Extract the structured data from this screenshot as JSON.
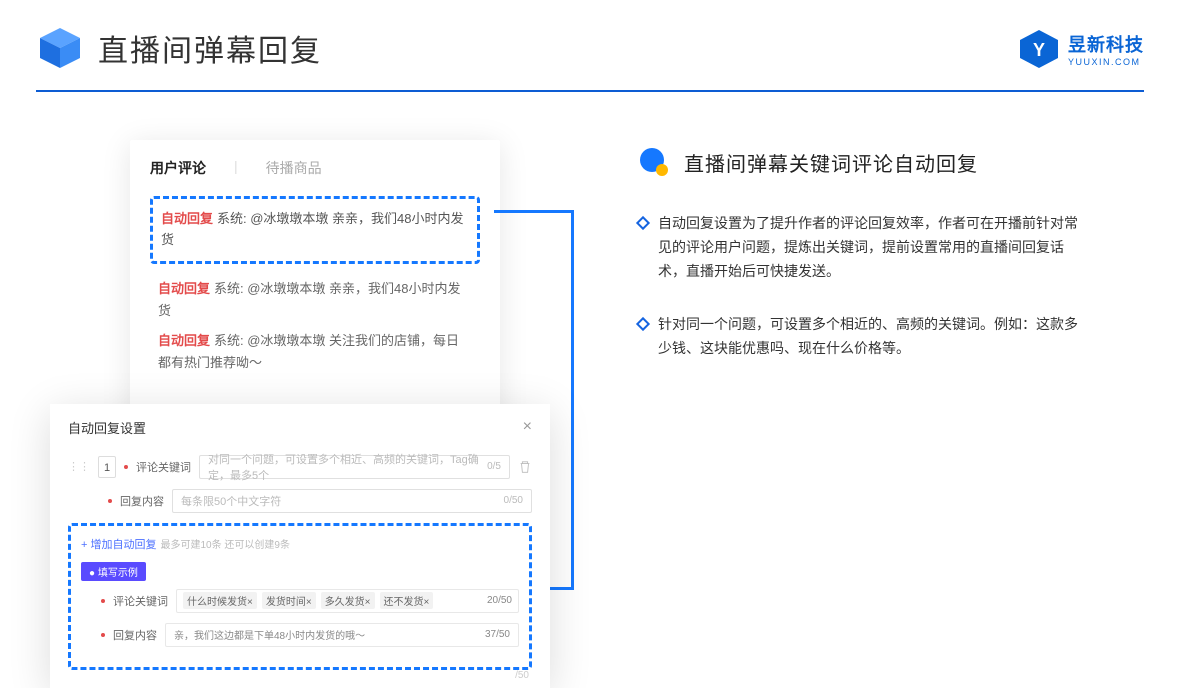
{
  "header": {
    "title": "直播间弹幕回复",
    "brand_cn": "昱新科技",
    "brand_en": "YUUXIN.COM"
  },
  "comments": {
    "tab1": "用户评论",
    "tab2": "待播商品",
    "auto_tag": "自动回复",
    "hl": "系统: @冰墩墩本墩 亲亲，我们48小时内发货",
    "r1": "系统: @冰墩墩本墩 亲亲，我们48小时内发货",
    "r2": "系统: @冰墩墩本墩 关注我们的店铺，每日都有热门推荐呦～"
  },
  "settings": {
    "title": "自动回复设置",
    "idx": "1",
    "lbl_kw": "评论关键词",
    "ph_kw": "对同一个问题，可设置多个相近、高频的关键词，Tag确定，最多5个",
    "cnt_kw": "0/5",
    "lbl_ct": "回复内容",
    "ph_ct": "每条限50个中文字符",
    "cnt_ct": "0/50",
    "add": "+ 增加自动回复",
    "add_hint": "最多可建10条 还可以创建9条",
    "ex_tag": "● 填写示例",
    "chip1": "什么时候发货×",
    "chip2": "发货时间×",
    "chip3": "多久发货×",
    "chip4": "还不发货×",
    "ex_kw_cnt": "20/50",
    "ex_ct": "亲，我们这边都是下单48小时内发货的哦～",
    "ex_ct_cnt": "37/50",
    "out_cnt": "/50"
  },
  "right": {
    "title": "直播间弹幕关键词评论自动回复",
    "b1": "自动回复设置为了提升作者的评论回复效率，作者可在开播前针对常见的评论用户问题，提炼出关键词，提前设置常用的直播间回复话术，直播开始后可快捷发送。",
    "b2": "针对同一个问题，可设置多个相近的、高频的关键词。例如：这款多少钱、这块能优惠吗、现在什么价格等。"
  }
}
